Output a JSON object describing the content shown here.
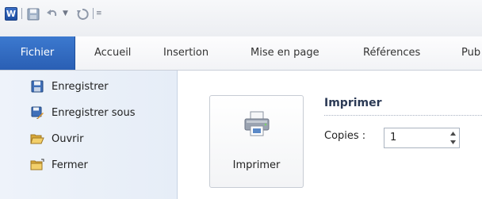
{
  "qat": {
    "app_logo": "W",
    "icons": [
      "word-logo-icon",
      "save-icon",
      "undo-icon",
      "dropdown-arrow-icon",
      "redo-icon",
      "customize-qat-icon"
    ]
  },
  "tabs": [
    {
      "label": "Fichier",
      "active": true
    },
    {
      "label": "Accueil"
    },
    {
      "label": "Insertion"
    },
    {
      "label": "Mise en page"
    },
    {
      "label": "Références"
    },
    {
      "label": "Pub"
    }
  ],
  "nav": [
    {
      "label": "Enregistrer",
      "icon": "save-icon"
    },
    {
      "label": "Enregistrer sous",
      "icon": "save-as-icon"
    },
    {
      "label": "Ouvrir",
      "icon": "open-folder-icon"
    },
    {
      "label": "Fermer",
      "icon": "close-folder-icon"
    }
  ],
  "print": {
    "button_label": "Imprimer",
    "section_title": "Imprimer",
    "copies_label": "Copies :",
    "copies_value": "1"
  },
  "colors": {
    "file_tab": "#2a5fb4",
    "backstage_nav": "#e9eff8"
  }
}
